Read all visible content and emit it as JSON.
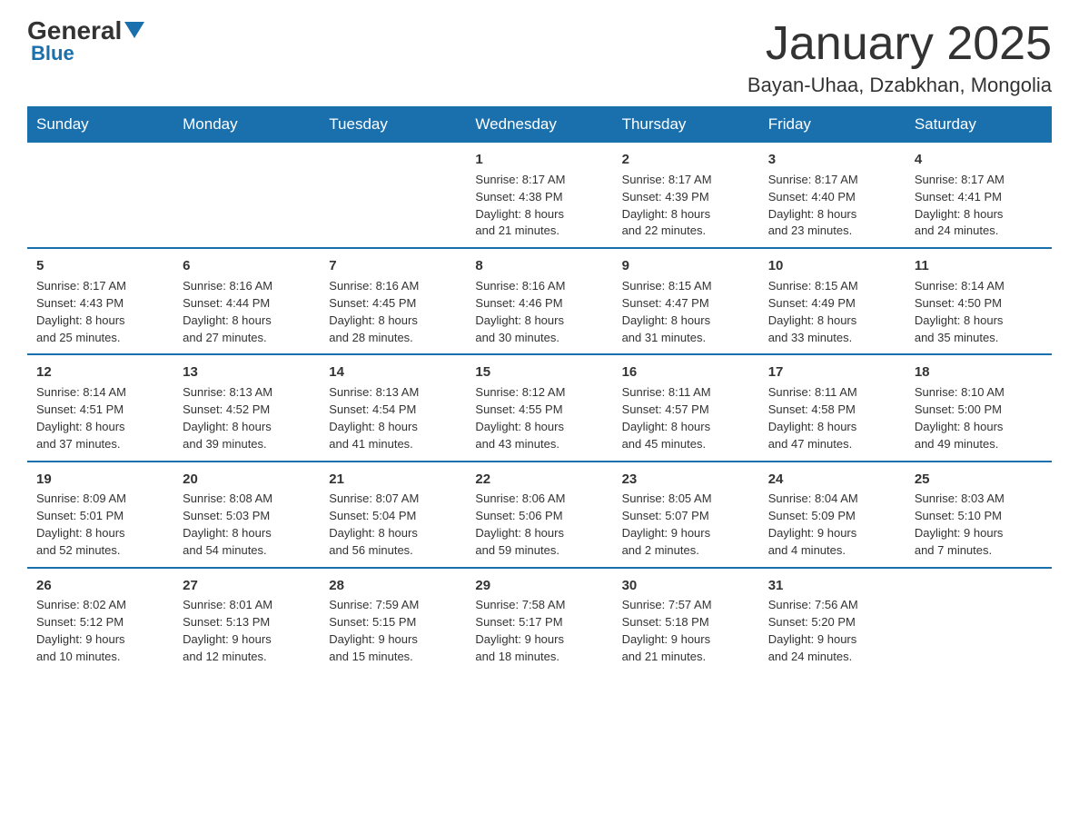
{
  "logo": {
    "text1": "General",
    "text2": "Blue"
  },
  "title": "January 2025",
  "subtitle": "Bayan-Uhaa, Dzabkhan, Mongolia",
  "days_header": [
    "Sunday",
    "Monday",
    "Tuesday",
    "Wednesday",
    "Thursday",
    "Friday",
    "Saturday"
  ],
  "weeks": [
    [
      {
        "day": "",
        "info": ""
      },
      {
        "day": "",
        "info": ""
      },
      {
        "day": "",
        "info": ""
      },
      {
        "day": "1",
        "info": "Sunrise: 8:17 AM\nSunset: 4:38 PM\nDaylight: 8 hours\nand 21 minutes."
      },
      {
        "day": "2",
        "info": "Sunrise: 8:17 AM\nSunset: 4:39 PM\nDaylight: 8 hours\nand 22 minutes."
      },
      {
        "day": "3",
        "info": "Sunrise: 8:17 AM\nSunset: 4:40 PM\nDaylight: 8 hours\nand 23 minutes."
      },
      {
        "day": "4",
        "info": "Sunrise: 8:17 AM\nSunset: 4:41 PM\nDaylight: 8 hours\nand 24 minutes."
      }
    ],
    [
      {
        "day": "5",
        "info": "Sunrise: 8:17 AM\nSunset: 4:43 PM\nDaylight: 8 hours\nand 25 minutes."
      },
      {
        "day": "6",
        "info": "Sunrise: 8:16 AM\nSunset: 4:44 PM\nDaylight: 8 hours\nand 27 minutes."
      },
      {
        "day": "7",
        "info": "Sunrise: 8:16 AM\nSunset: 4:45 PM\nDaylight: 8 hours\nand 28 minutes."
      },
      {
        "day": "8",
        "info": "Sunrise: 8:16 AM\nSunset: 4:46 PM\nDaylight: 8 hours\nand 30 minutes."
      },
      {
        "day": "9",
        "info": "Sunrise: 8:15 AM\nSunset: 4:47 PM\nDaylight: 8 hours\nand 31 minutes."
      },
      {
        "day": "10",
        "info": "Sunrise: 8:15 AM\nSunset: 4:49 PM\nDaylight: 8 hours\nand 33 minutes."
      },
      {
        "day": "11",
        "info": "Sunrise: 8:14 AM\nSunset: 4:50 PM\nDaylight: 8 hours\nand 35 minutes."
      }
    ],
    [
      {
        "day": "12",
        "info": "Sunrise: 8:14 AM\nSunset: 4:51 PM\nDaylight: 8 hours\nand 37 minutes."
      },
      {
        "day": "13",
        "info": "Sunrise: 8:13 AM\nSunset: 4:52 PM\nDaylight: 8 hours\nand 39 minutes."
      },
      {
        "day": "14",
        "info": "Sunrise: 8:13 AM\nSunset: 4:54 PM\nDaylight: 8 hours\nand 41 minutes."
      },
      {
        "day": "15",
        "info": "Sunrise: 8:12 AM\nSunset: 4:55 PM\nDaylight: 8 hours\nand 43 minutes."
      },
      {
        "day": "16",
        "info": "Sunrise: 8:11 AM\nSunset: 4:57 PM\nDaylight: 8 hours\nand 45 minutes."
      },
      {
        "day": "17",
        "info": "Sunrise: 8:11 AM\nSunset: 4:58 PM\nDaylight: 8 hours\nand 47 minutes."
      },
      {
        "day": "18",
        "info": "Sunrise: 8:10 AM\nSunset: 5:00 PM\nDaylight: 8 hours\nand 49 minutes."
      }
    ],
    [
      {
        "day": "19",
        "info": "Sunrise: 8:09 AM\nSunset: 5:01 PM\nDaylight: 8 hours\nand 52 minutes."
      },
      {
        "day": "20",
        "info": "Sunrise: 8:08 AM\nSunset: 5:03 PM\nDaylight: 8 hours\nand 54 minutes."
      },
      {
        "day": "21",
        "info": "Sunrise: 8:07 AM\nSunset: 5:04 PM\nDaylight: 8 hours\nand 56 minutes."
      },
      {
        "day": "22",
        "info": "Sunrise: 8:06 AM\nSunset: 5:06 PM\nDaylight: 8 hours\nand 59 minutes."
      },
      {
        "day": "23",
        "info": "Sunrise: 8:05 AM\nSunset: 5:07 PM\nDaylight: 9 hours\nand 2 minutes."
      },
      {
        "day": "24",
        "info": "Sunrise: 8:04 AM\nSunset: 5:09 PM\nDaylight: 9 hours\nand 4 minutes."
      },
      {
        "day": "25",
        "info": "Sunrise: 8:03 AM\nSunset: 5:10 PM\nDaylight: 9 hours\nand 7 minutes."
      }
    ],
    [
      {
        "day": "26",
        "info": "Sunrise: 8:02 AM\nSunset: 5:12 PM\nDaylight: 9 hours\nand 10 minutes."
      },
      {
        "day": "27",
        "info": "Sunrise: 8:01 AM\nSunset: 5:13 PM\nDaylight: 9 hours\nand 12 minutes."
      },
      {
        "day": "28",
        "info": "Sunrise: 7:59 AM\nSunset: 5:15 PM\nDaylight: 9 hours\nand 15 minutes."
      },
      {
        "day": "29",
        "info": "Sunrise: 7:58 AM\nSunset: 5:17 PM\nDaylight: 9 hours\nand 18 minutes."
      },
      {
        "day": "30",
        "info": "Sunrise: 7:57 AM\nSunset: 5:18 PM\nDaylight: 9 hours\nand 21 minutes."
      },
      {
        "day": "31",
        "info": "Sunrise: 7:56 AM\nSunset: 5:20 PM\nDaylight: 9 hours\nand 24 minutes."
      },
      {
        "day": "",
        "info": ""
      }
    ]
  ]
}
